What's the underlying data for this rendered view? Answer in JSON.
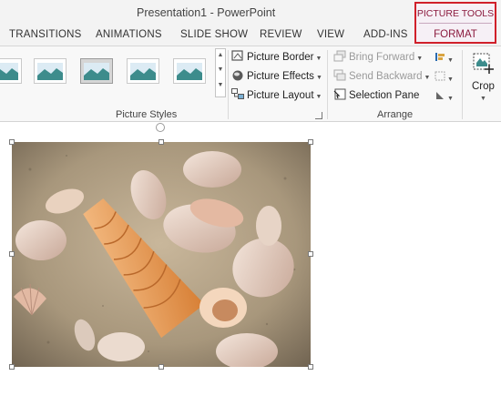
{
  "window": {
    "title": "Presentation1 - PowerPoint"
  },
  "tabs": [
    "TRANSITIONS",
    "ANIMATIONS",
    "SLIDE SHOW",
    "REVIEW",
    "VIEW",
    "ADD-INS"
  ],
  "contextual": {
    "group_label": "PICTURE TOOLS",
    "tab_label": "FORMAT"
  },
  "picture_styles": {
    "group_label": "Picture Styles",
    "commands": {
      "border": "Picture Border",
      "effects": "Picture Effects",
      "layout": "Picture Layout"
    }
  },
  "arrange": {
    "group_label": "Arrange",
    "commands": {
      "bring_forward": "Bring Forward",
      "send_backward": "Send Backward",
      "selection_pane": "Selection Pane"
    }
  },
  "size": {
    "crop_label": "Crop"
  },
  "colors": {
    "accent": "#d0202a",
    "context_text": "#8b1a3e"
  }
}
